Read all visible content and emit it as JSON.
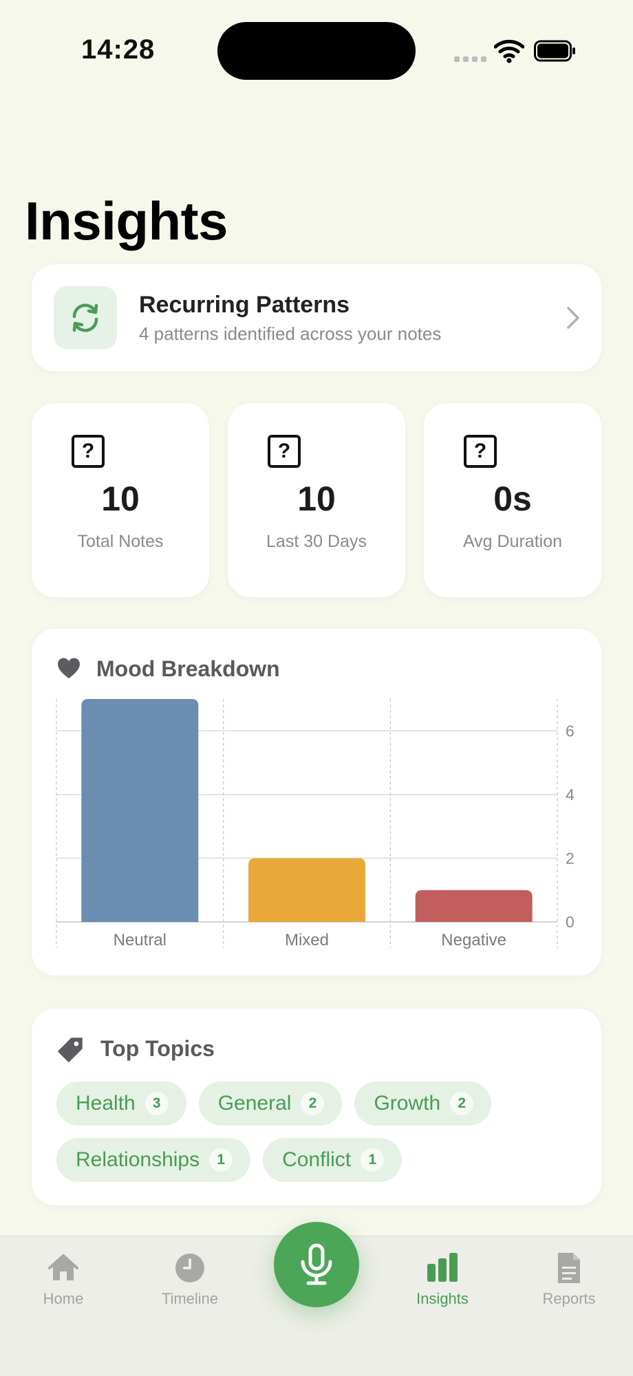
{
  "status_bar": {
    "time": "14:28"
  },
  "page": {
    "title": "Insights"
  },
  "patterns": {
    "title": "Recurring Patterns",
    "subtitle": "4 patterns identified across your notes",
    "icon": "repeat-icon"
  },
  "stats": [
    {
      "value": "10",
      "label": "Total Notes",
      "icon": "question-icon"
    },
    {
      "value": "10",
      "label": "Last 30 Days",
      "icon": "question-icon"
    },
    {
      "value": "0s",
      "label": "Avg Duration",
      "icon": "question-icon"
    }
  ],
  "mood": {
    "title": "Mood Breakdown",
    "icon": "heart-icon"
  },
  "chart_data": {
    "type": "bar",
    "title": "Mood Breakdown",
    "categories": [
      "Neutral",
      "Mixed",
      "Negative"
    ],
    "values": [
      7,
      2,
      1
    ],
    "colors": [
      "#6a8db1",
      "#e8a93a",
      "#c25e5e"
    ],
    "ylim": [
      0,
      7
    ],
    "yticks": [
      0,
      2,
      4,
      6
    ],
    "y_axis_side": "right",
    "grid": true
  },
  "topics": {
    "title": "Top Topics",
    "icon": "tag-icon",
    "items": [
      {
        "label": "Health",
        "count": "3"
      },
      {
        "label": "General",
        "count": "2"
      },
      {
        "label": "Growth",
        "count": "2"
      },
      {
        "label": "Relationships",
        "count": "1"
      },
      {
        "label": "Conflict",
        "count": "1"
      }
    ]
  },
  "tabs": [
    {
      "label": "Home",
      "icon": "home-icon"
    },
    {
      "label": "Timeline",
      "icon": "clock-icon"
    },
    {
      "label": "Insights",
      "icon": "bar-chart-icon",
      "active": true
    },
    {
      "label": "Reports",
      "icon": "document-icon"
    }
  ],
  "record": {
    "icon": "microphone-icon"
  },
  "colors": {
    "accent": "#4ba657",
    "background": "#f6f8ec"
  }
}
